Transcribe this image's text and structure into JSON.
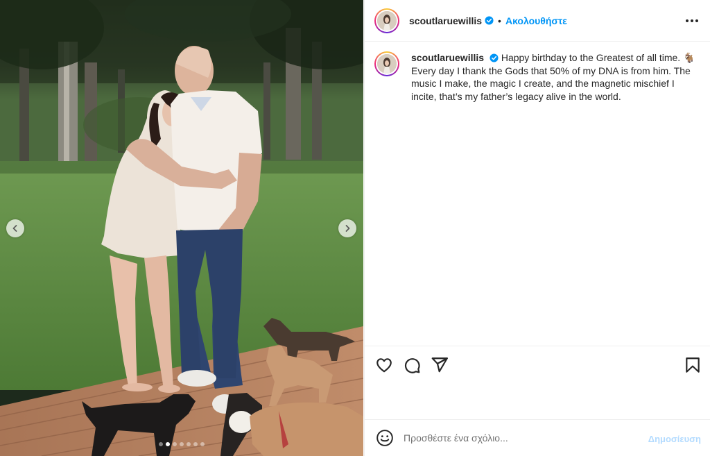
{
  "post": {
    "username": "scoutlaruewillis",
    "follow_label": "Ακολουθήστε",
    "separator": "•",
    "caption": "Happy birthday to the Greatest of all time. 🐐 Every day I thank the Gods that 50% of my DNA is from him. The music I make, the magic I create, and the magnetic mischief I incite, that’s my father’s legacy alive in the world."
  },
  "carousel": {
    "slide_count": 7,
    "active_index": 1
  },
  "comment": {
    "placeholder": "Προσθέστε ένα σχόλιο...",
    "post_label": "Δημοσίευση"
  },
  "icons": {
    "verified": "verified-badge-icon",
    "more": "more-options-icon",
    "like": "heart-icon",
    "comment": "comment-bubble-icon",
    "share": "paper-plane-icon",
    "save": "bookmark-icon",
    "emoji": "emoji-smiley-icon",
    "prev": "chevron-left-icon",
    "next": "chevron-right-icon"
  },
  "colors": {
    "accent": "#0095f6",
    "post_disabled": "#b3dbff",
    "text": "#262626",
    "muted": "#737373",
    "border": "#efefef"
  }
}
